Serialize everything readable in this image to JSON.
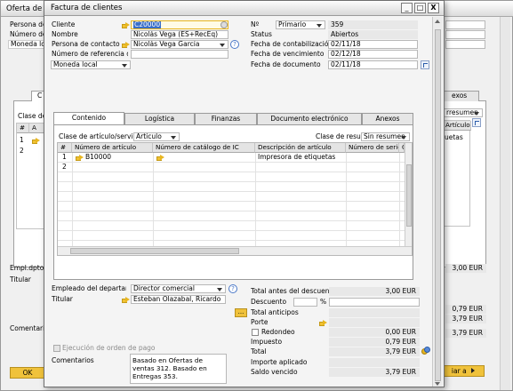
{
  "background": {
    "window_title": "Oferta de",
    "fields": [
      "Persona de",
      "Número de",
      "Moneda local"
    ],
    "tab_label": "C",
    "tab_right": "exos",
    "clase_label": "Clase de",
    "col_hash": "#",
    "col_a": "A",
    "rows": [
      "1",
      "2"
    ],
    "right_labels": [
      "rresumen",
      "Artículo",
      "uetas"
    ],
    "empl_label": "Empl.dpto.",
    "titular_label": "Titular",
    "coment_label": "Comentario",
    "right_values": [
      "3,00 EUR",
      "0,79 EUR",
      "3,79 EUR",
      "3,79 EUR"
    ],
    "ok_label": "OK",
    "copy_label": "iar a"
  },
  "window": {
    "title": "Factura de clientes",
    "controls": [
      "_",
      "□",
      "X"
    ]
  },
  "header_left": {
    "cliente_label": "Cliente",
    "cliente_value": "C20000",
    "nombre_label": "Nombre",
    "nombre_value": "Nicolás Vega (ES+RecEq)",
    "persona_label": "Persona de contacto",
    "persona_value": "Nicolás Vega García",
    "referencia_label": "Número de referencia d",
    "referencia_value": "",
    "moneda_value": "Moneda local"
  },
  "header_right": {
    "no_label": "Nº",
    "serie_value": "Primario",
    "no_value": "359",
    "status_label": "Status",
    "status_value": "Abiertos",
    "fecha_cont_label": "Fecha de contabilización",
    "fecha_cont_value": "02/11/18",
    "fecha_venc_label": "Fecha de vencimiento",
    "fecha_venc_value": "02/12/18",
    "fecha_doc_label": "Fecha de documento",
    "fecha_doc_value": "02/11/18"
  },
  "tabs": [
    "Contenido",
    "Logística",
    "Finanzas",
    "Documento electrónico",
    "Anexos"
  ],
  "content": {
    "clase_label": "Clase de artículo/servicio",
    "clase_value": "Artículo",
    "resumen_label": "Clase de resumen",
    "resumen_value": "Sin resumen",
    "columns": [
      "#",
      "Número de artículo",
      "Número de catálogo de IC",
      "Descripción de artículo",
      "Número de serie",
      "C"
    ],
    "rows": [
      {
        "num": "1",
        "item": "B10000",
        "desc": "Impresora de etiquetas"
      },
      {
        "num": "2",
        "item": "",
        "desc": ""
      }
    ]
  },
  "footer_left": {
    "empleado_label": "Empleado del departam",
    "empleado_value": "Director comercial",
    "titular_label": "Titular",
    "titular_value": "Esteban Olazabal, Ricardo",
    "ejecucion_label": "Ejecución de orden de pago",
    "comentarios_label": "Comentarios",
    "comentarios_value": "Basado en Ofertas de ventas 312. Basado en Entregas 353."
  },
  "footer_right": {
    "total_antes_label": "Total antes del descuento",
    "total_antes_value": "3,00 EUR",
    "descuento_label": "Descuento",
    "descuento_pct": "%",
    "total_anticipos_label": "Total anticipos",
    "porte_label": "Porte",
    "redondeo_label": "Redondeo",
    "redondeo_value": "0,00 EUR",
    "impuesto_label": "Impuesto",
    "impuesto_value": "0,79 EUR",
    "total_label": "Total",
    "total_value": "3,79 EUR",
    "importe_aplicado_label": "Importe aplicado",
    "saldo_label": "Saldo vencido",
    "saldo_value": "3,79 EUR",
    "ellipsis": "..."
  }
}
